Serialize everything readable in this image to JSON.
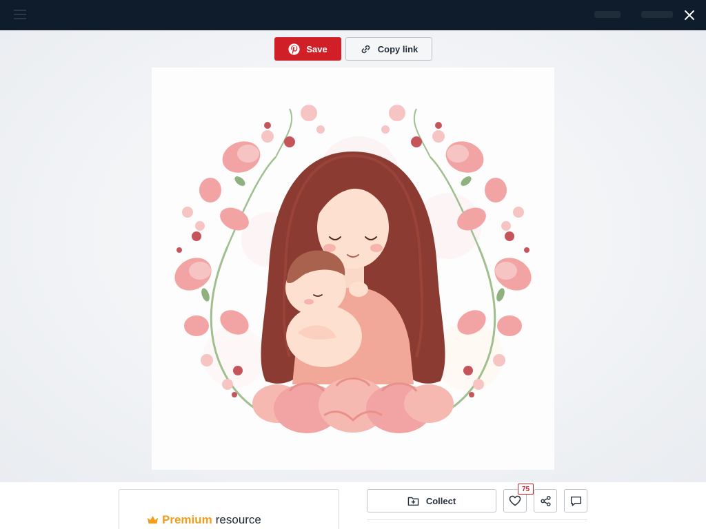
{
  "share": {
    "save_label": "Save",
    "copy_label": "Copy link"
  },
  "resource": {
    "premium_label": "Premium",
    "resource_label": "resource"
  },
  "actions": {
    "collect_label": "Collect",
    "like_count": "75"
  },
  "colors": {
    "pinterest_red": "#d01f26",
    "premium_gold": "#f29d1b",
    "topbar": "#0f1c2b"
  },
  "icons": [
    "close-icon",
    "pinterest-icon",
    "link-icon",
    "folder-add-icon",
    "heart-icon",
    "share-icon",
    "comment-icon",
    "crown-icon"
  ]
}
